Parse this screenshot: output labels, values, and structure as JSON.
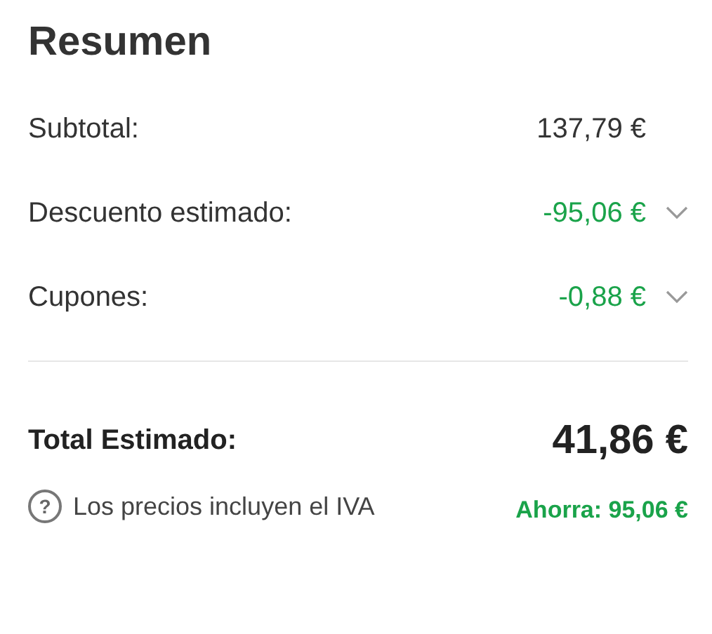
{
  "title": "Resumen",
  "rows": [
    {
      "label": "Subtotal:",
      "value": "137,79 €",
      "kind": "amount"
    },
    {
      "label": "Descuento estimado:",
      "value": "-95,06 €",
      "kind": "discount",
      "expanded": false
    },
    {
      "label": "Cupones:",
      "value": "-0,88 €",
      "kind": "discount",
      "expanded": false
    }
  ],
  "total": {
    "label": "Total Estimado:",
    "value": "41,86 €"
  },
  "note": {
    "icon": "?",
    "text": "Los precios incluyen el IVA",
    "savings": "Ahorra: 95,06 €"
  }
}
